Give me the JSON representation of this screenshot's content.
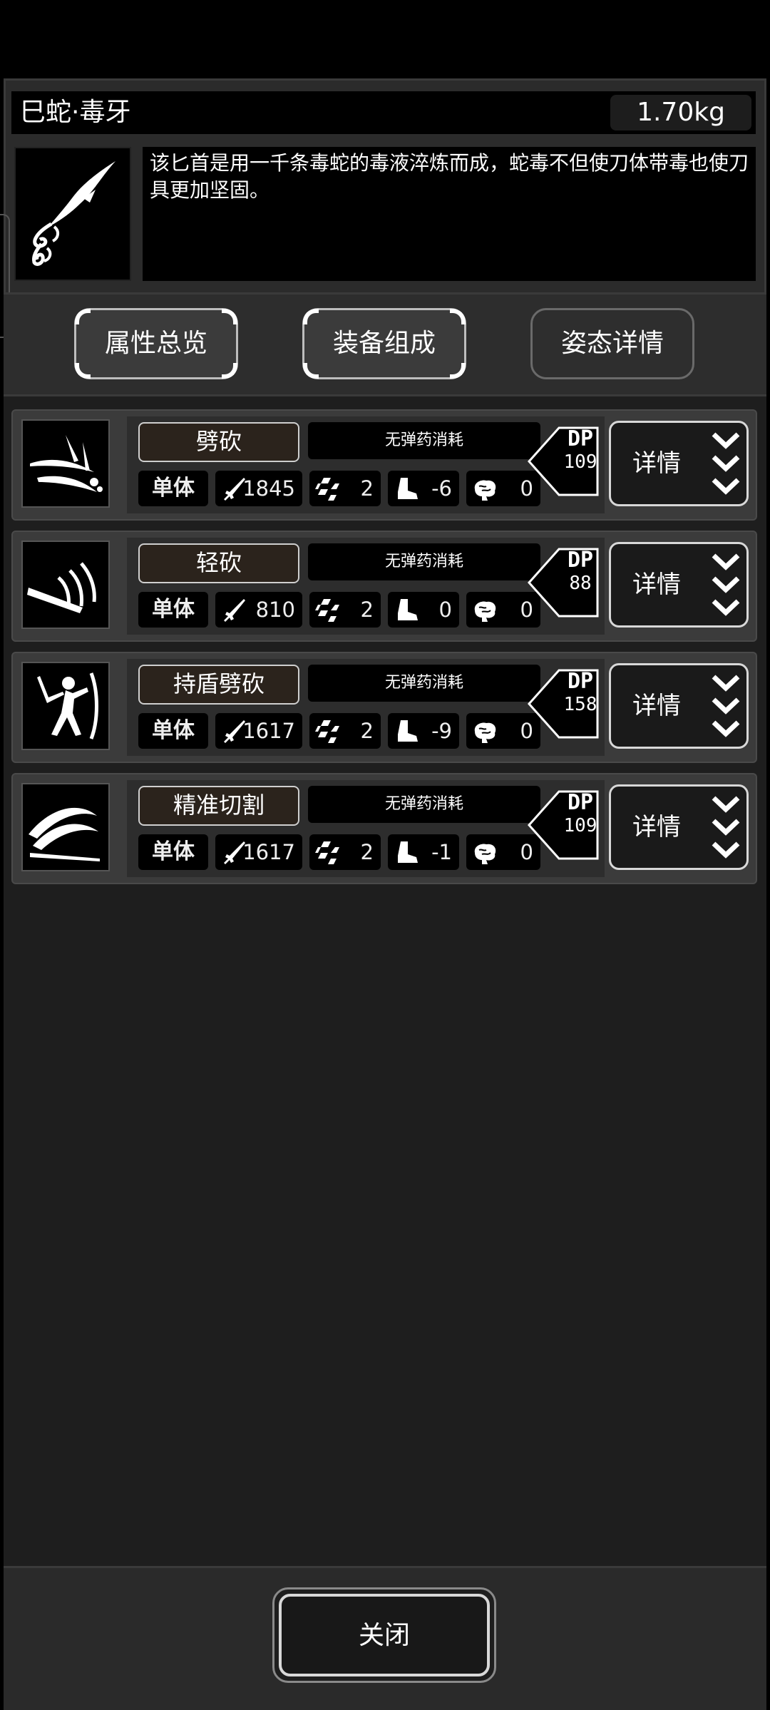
{
  "item": {
    "name": "巳蛇·毒牙",
    "weight": "1.70kg",
    "description": "该匕首是用一千条毒蛇的毒液淬炼而成，蛇毒不但使刀体带毒也使刀具更加坚固。",
    "icon": "serpent-dagger-icon"
  },
  "tabs": [
    {
      "label": "属性总览",
      "active": false
    },
    {
      "label": "装备组成",
      "active": false
    },
    {
      "label": "姿态详情",
      "active": true
    }
  ],
  "skills": [
    {
      "name": "劈砍",
      "ammo": "无弹药消耗",
      "target": "单体",
      "attack": "1845",
      "accuracy": "2",
      "move": "-6",
      "mind": "0",
      "dp_label": "DP",
      "dp": "109",
      "detail": "详情",
      "icon": "chop-slash-icon"
    },
    {
      "name": "轻砍",
      "ammo": "无弹药消耗",
      "target": "单体",
      "attack": "810",
      "accuracy": "2",
      "move": "0",
      "mind": "0",
      "dp_label": "DP",
      "dp": "88",
      "detail": "详情",
      "icon": "light-slash-icon"
    },
    {
      "name": "持盾劈砍",
      "ammo": "无弹药消耗",
      "target": "单体",
      "attack": "1617",
      "accuracy": "2",
      "move": "-9",
      "mind": "0",
      "dp_label": "DP",
      "dp": "158",
      "detail": "详情",
      "icon": "shield-slash-icon"
    },
    {
      "name": "精准切割",
      "ammo": "无弹药消耗",
      "target": "单体",
      "attack": "1617",
      "accuracy": "2",
      "move": "-1",
      "mind": "0",
      "dp_label": "DP",
      "dp": "109",
      "detail": "详情",
      "icon": "precise-cut-icon"
    }
  ],
  "footer": {
    "close_label": "关闭"
  }
}
